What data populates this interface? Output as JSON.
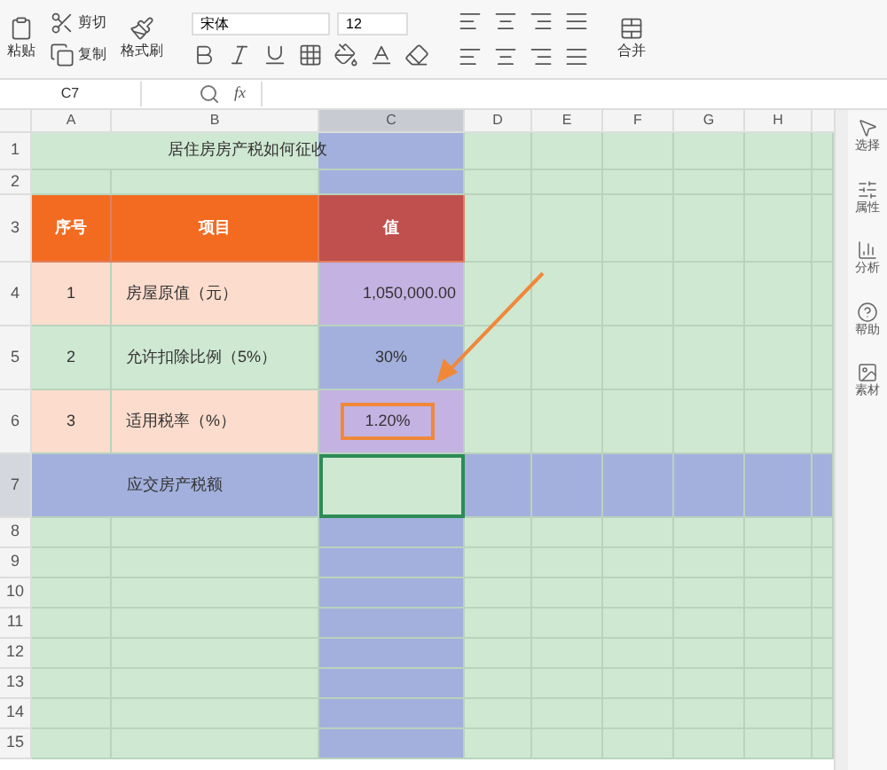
{
  "toolbar": {
    "clipboard": [
      {
        "label": "粘贴"
      },
      {
        "label": "剪切"
      },
      {
        "label": "复制"
      },
      {
        "label": "格式刷"
      }
    ],
    "font": {
      "name": "宋体",
      "size": "12"
    },
    "merge": {
      "label": "合并"
    }
  },
  "formula_bar": {
    "name_box": "C7",
    "fx": "fx"
  },
  "columns": [
    {
      "label": "A",
      "selected": false
    },
    {
      "label": "B",
      "selected": false
    },
    {
      "label": "C",
      "selected": true
    },
    {
      "label": "D",
      "selected": false
    },
    {
      "label": "E",
      "selected": false
    },
    {
      "label": "F",
      "selected": false
    },
    {
      "label": "G",
      "selected": false
    },
    {
      "label": "H",
      "selected": false
    }
  ],
  "rows": [
    {
      "number": "1",
      "kind": "title",
      "text": "居住房房产税如何征收"
    },
    {
      "number": "2",
      "kind": "gap"
    },
    {
      "number": "3",
      "kind": "header",
      "cells": [
        "序号",
        "项目",
        "值"
      ]
    },
    {
      "number": "4",
      "kind": "item",
      "color": "#fbdccd",
      "cells": [
        "1",
        "房屋原值（元）",
        "1,050,000.00"
      ],
      "boxed": false
    },
    {
      "number": "5",
      "kind": "item",
      "color": "#cfe8d2",
      "cells": [
        "2",
        "允许扣除比例（5%）",
        "30%"
      ],
      "boxed": false
    },
    {
      "number": "6",
      "kind": "item",
      "color": "#fbdccd",
      "cells": [
        "3",
        "适用税率（%）",
        "1.20%"
      ],
      "boxed": true
    },
    {
      "number": "7",
      "kind": "total",
      "text": "应交房产税额",
      "selected": true
    },
    {
      "number": "8",
      "kind": "empty"
    },
    {
      "number": "9",
      "kind": "empty"
    },
    {
      "number": "10",
      "kind": "empty"
    },
    {
      "number": "11",
      "kind": "empty"
    },
    {
      "number": "12",
      "kind": "empty"
    },
    {
      "number": "13",
      "kind": "empty"
    },
    {
      "number": "14",
      "kind": "empty"
    },
    {
      "number": "15",
      "kind": "empty"
    }
  ],
  "side_panel": [
    {
      "label": "选择"
    },
    {
      "label": "属性"
    },
    {
      "label": "分析"
    },
    {
      "label": "帮助"
    },
    {
      "label": "素材"
    }
  ]
}
